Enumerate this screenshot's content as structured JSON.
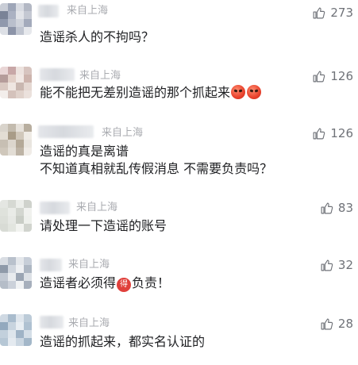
{
  "comments": [
    {
      "location": "来自上海",
      "likes": "273",
      "lines": [
        "造谣杀人的不拘吗？"
      ],
      "avatar_colors": [
        "#c9cdd6",
        "#9ea6b8",
        "#d8dbe2",
        "#b3b8c4",
        "#7a8397",
        "#aab1c2",
        "#e1e3e8",
        "#c4c8d2",
        "#9099ad",
        "#b9bfcc",
        "#cfd3db",
        "#a3aabb",
        "#dde0e6",
        "#8c94a8",
        "#c0c5d0",
        "#e6e8ec"
      ]
    },
    {
      "location": "来自上海",
      "likes": "126",
      "lines": [
        "能不能把无差别造谣的那个抓起来"
      ],
      "emojis": [
        "angry-face",
        "angry-face"
      ],
      "avatar_colors": [
        "#e9d6d6",
        "#c8a7a7",
        "#ede3df",
        "#d7c4bf",
        "#b59c9a",
        "#e2cfc7",
        "#f1e8e4",
        "#cdb4ad",
        "#dac9c2",
        "#efe6e1",
        "#c9b7b0",
        "#e5d8d2",
        "#f3eeeb",
        "#d4c2bb",
        "#e0d2cb",
        "#ebe1dc"
      ]
    },
    {
      "location": "来自上海",
      "likes": "126",
      "lines": [
        "造谣的真是离谱",
        "不知道真相就乱传假消息 不需要负责吗？"
      ],
      "avatar_colors": [
        "#d9d4cc",
        "#c3bbae",
        "#e6e1da",
        "#b8ae9f",
        "#e3ddd4",
        "#a99c88",
        "#d1c8bb",
        "#efebe5",
        "#c7bfb3",
        "#dcd6cd",
        "#b4a998",
        "#e9e5df",
        "#cfc7bb",
        "#e2ddd5",
        "#bdb3a5",
        "#f0ece7"
      ]
    },
    {
      "location": "来自上海",
      "likes": "83",
      "lines": [
        "请处理一下造谣的账号"
      ],
      "avatar_colors": [
        "#e4e6e2",
        "#d6d9d3",
        "#eceeea",
        "#cfd2cc",
        "#dfe2dc",
        "#e9ebe7",
        "#d3d6d0",
        "#f0f1ee",
        "#dcdfd9",
        "#e6e8e4",
        "#c9cdc6",
        "#eef0ec",
        "#d8dbd5",
        "#e2e5df",
        "#f2f3f0",
        "#d1d4ce"
      ]
    },
    {
      "location": "来自上海",
      "likes": "32",
      "lines": [
        "造谣者必须得",
        "负责！"
      ],
      "badge": "得",
      "avatar_colors": [
        "#d9dde3",
        "#b9c1cc",
        "#e4e7eb",
        "#c7ced8",
        "#8f9aa9",
        "#d0d6de",
        "#eef0f3",
        "#aeb7c3",
        "#c2c9d3",
        "#e8ebee",
        "#9ba5b3",
        "#dde1e6",
        "#b5bdc8",
        "#cbd1da",
        "#f0f2f4",
        "#a6afbc"
      ]
    },
    {
      "location": "来自上海",
      "likes": "28",
      "lines": [
        "造谣的抓起来，都实名认证的"
      ],
      "avatar_colors": [
        "#cfd9e3",
        "#a9bccd",
        "#dfe6ed",
        "#bccbd8",
        "#93a9be",
        "#c8d4df",
        "#e8eef3",
        "#afc1d1",
        "#c2d0dc",
        "#dde5ec",
        "#9fb3c6",
        "#d4dee7",
        "#b6c7d5",
        "#e4eaf0",
        "#cad6e1",
        "#a3b7c9"
      ]
    }
  ],
  "accent_color": "#6f7278"
}
